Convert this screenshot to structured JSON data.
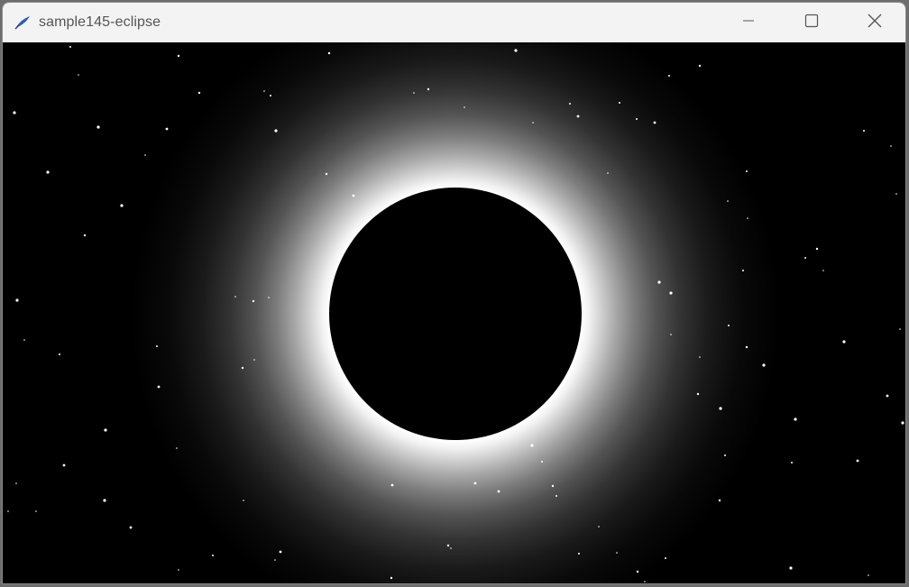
{
  "window": {
    "title": "sample145-eclipse",
    "app_icon": "feather-icon",
    "controls": {
      "minimize_icon": "minimize-icon",
      "maximize_icon": "maximize-icon",
      "close_icon": "close-icon"
    }
  },
  "scene": {
    "background_color": "#000000",
    "corona_color": "#ffffff",
    "moon_color": "#000000",
    "star_color": "#ffffff"
  }
}
